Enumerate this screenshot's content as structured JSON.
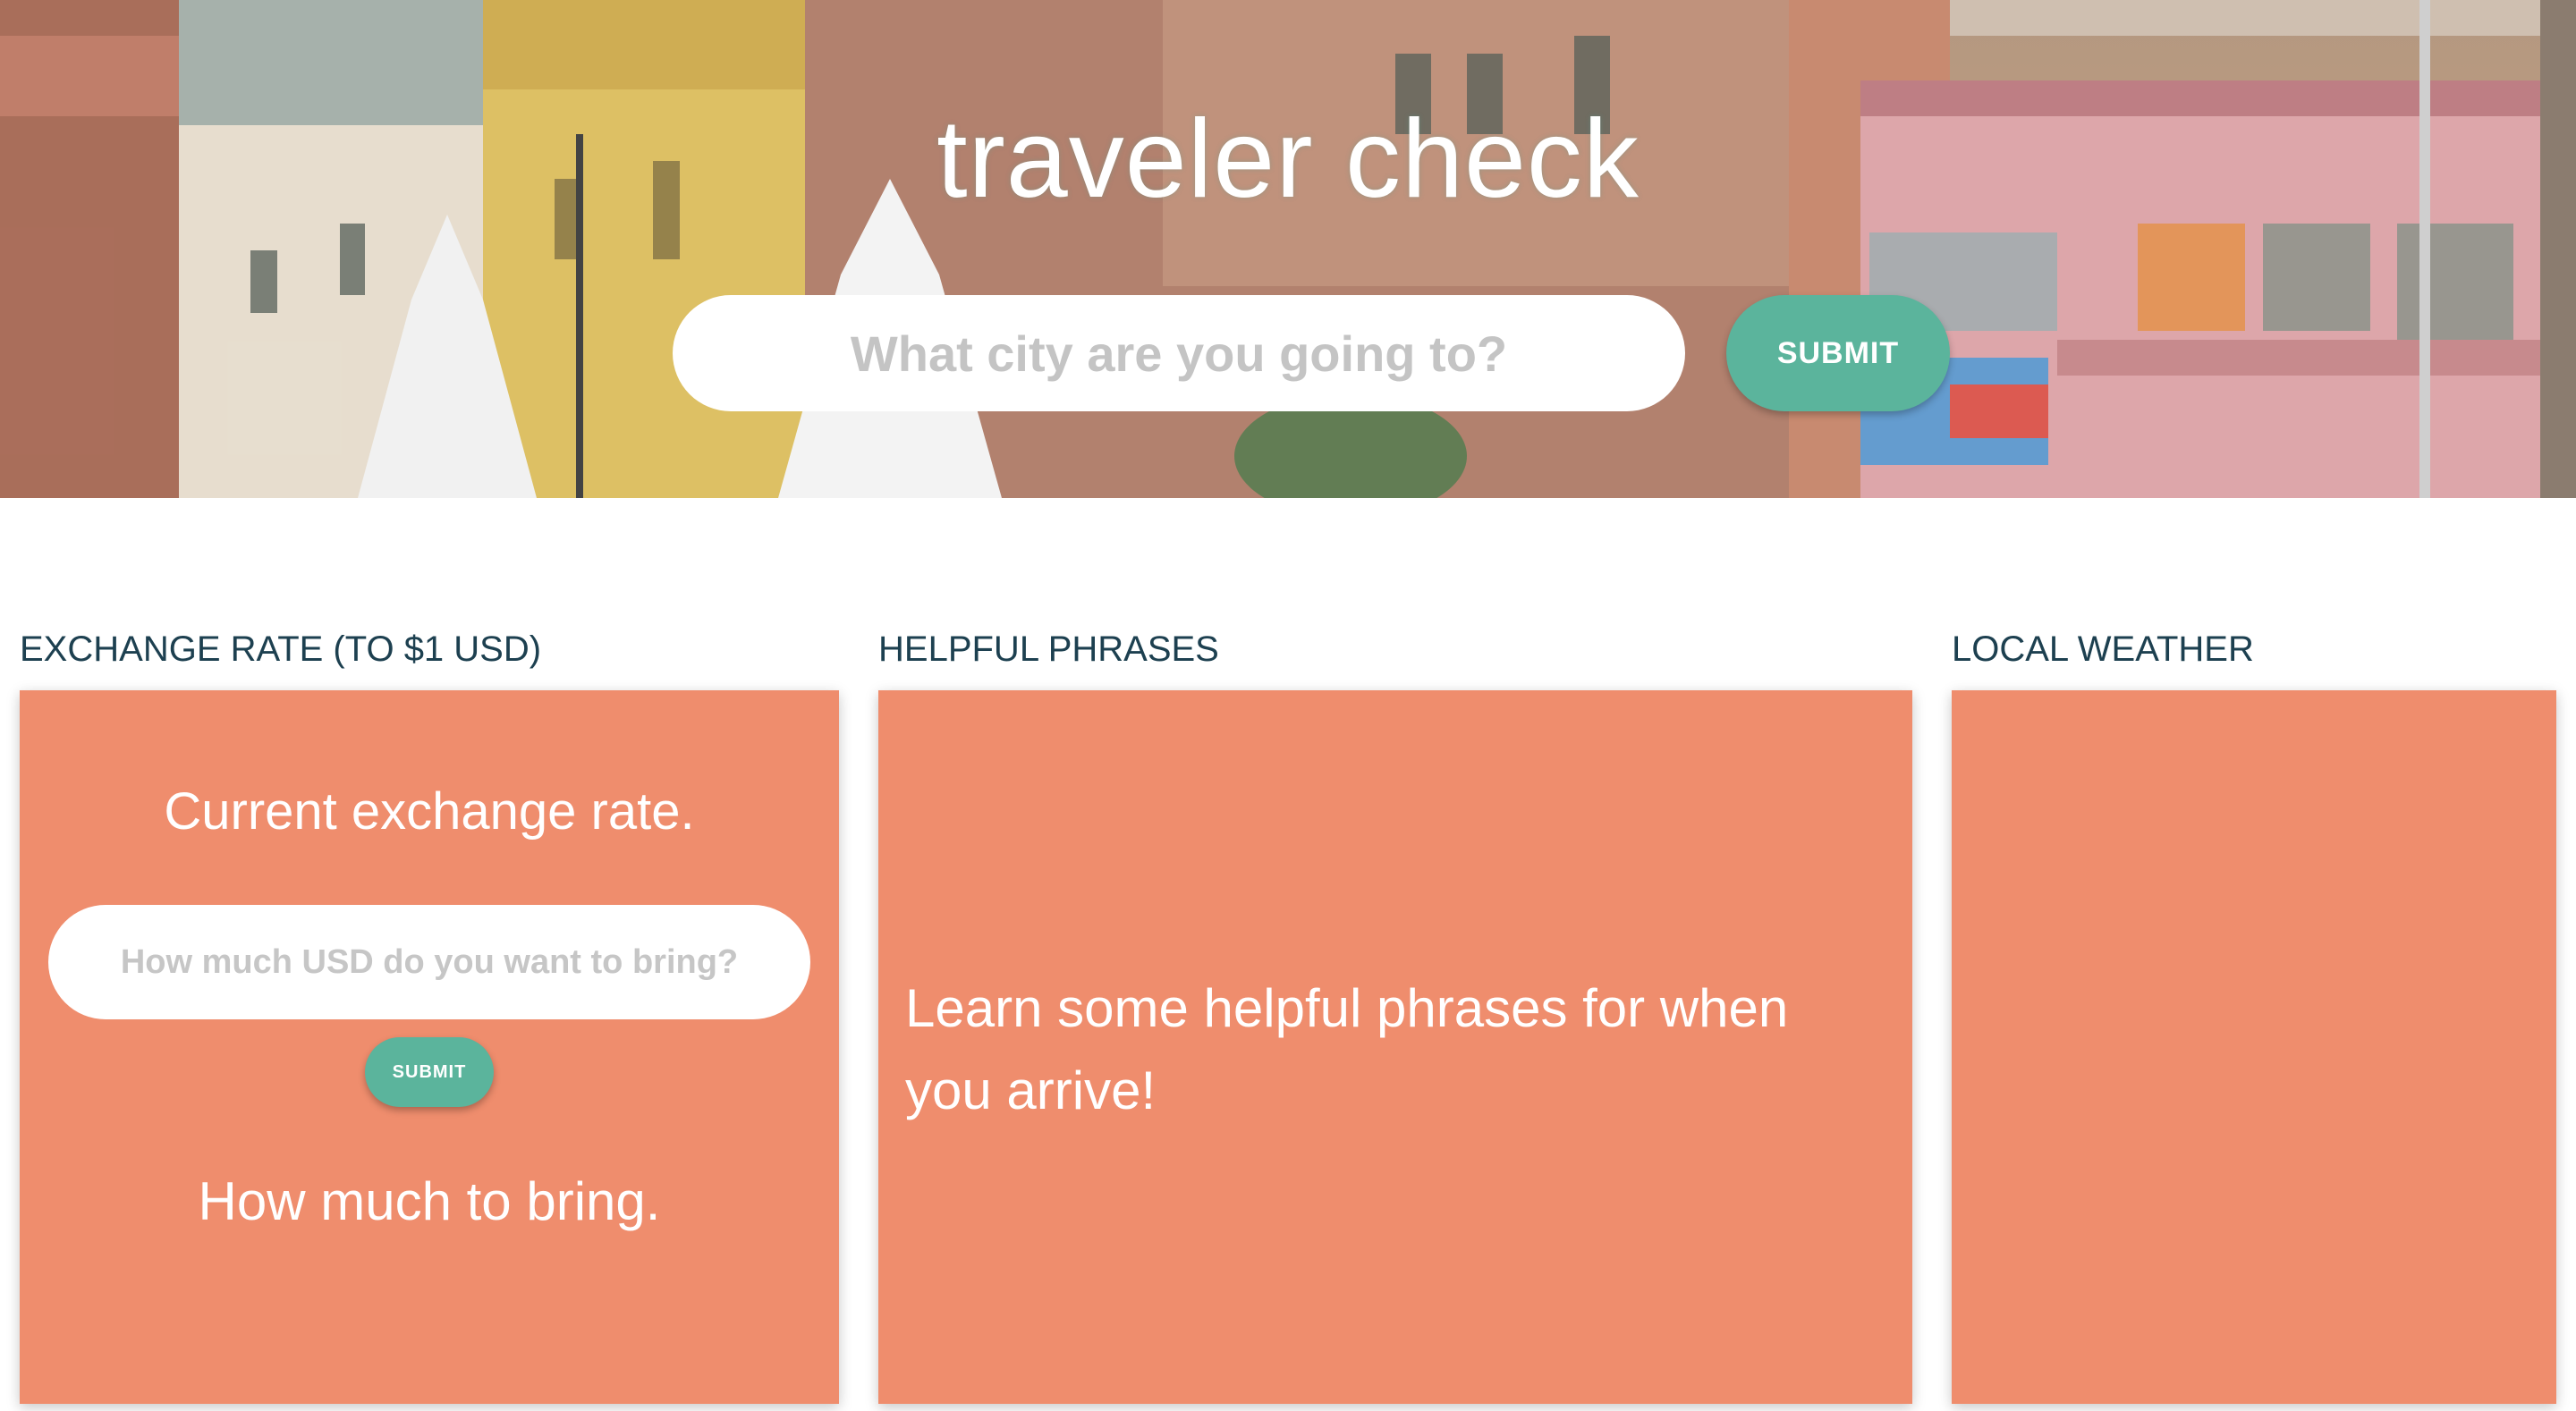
{
  "hero": {
    "title": "traveler check",
    "city_placeholder": "What city are you going to?",
    "submit_label": "SUBMIT"
  },
  "sections": {
    "exchange": {
      "heading": "EXCHANGE RATE (TO $1 USD)",
      "current_rate": "Current exchange rate.",
      "usd_placeholder": "How much USD do you want to bring?",
      "submit_label": "SUBMIT",
      "how_much": "How much to bring."
    },
    "phrases": {
      "heading": "HELPFUL PHRASES",
      "text": "Learn some helpful phrases for when you arrive!"
    },
    "weather": {
      "heading": "LOCAL WEATHER"
    }
  },
  "colors": {
    "card": "#ef8d6d",
    "accent": "#5bb49c",
    "heading": "#1d4050"
  }
}
